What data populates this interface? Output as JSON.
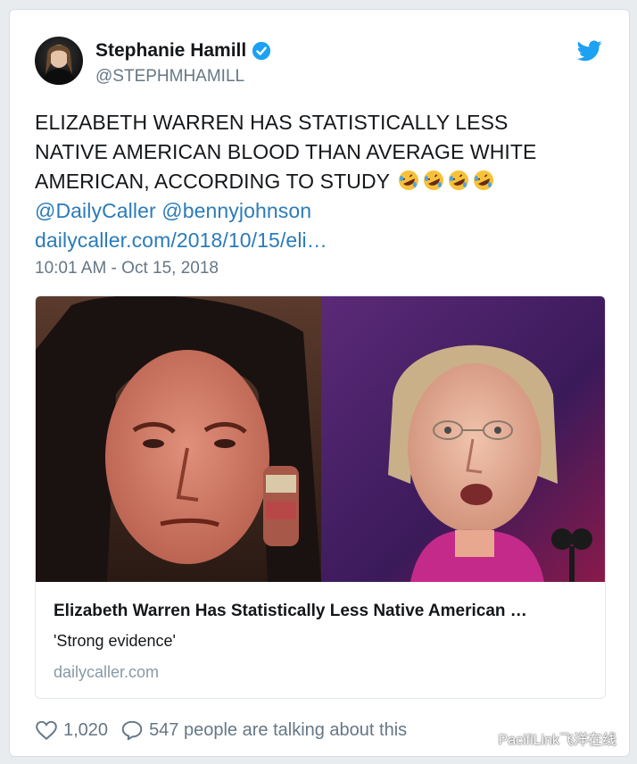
{
  "user": {
    "display_name": "Stephanie Hamill",
    "handle": "@STEPHMHAMILL"
  },
  "tweet": {
    "text_lines": [
      "ELIZABETH WARREN HAS STATISTICALLY LESS",
      "NATIVE AMERICAN BLOOD THAN AVERAGE WHITE",
      "AMERICAN, ACCORDING TO STUDY"
    ],
    "emoji_count": 4,
    "mentions": [
      "@DailyCaller",
      "@bennyjohnson"
    ],
    "link": "dailycaller.com/2018/10/15/eli…",
    "timestamp": "10:01 AM - Oct 15, 2018"
  },
  "card": {
    "title": "Elizabeth Warren Has Statistically Less Native American …",
    "description": "'Strong evidence'",
    "domain": "dailycaller.com"
  },
  "actions": {
    "likes": "1,020",
    "talking": "547 people are talking about this"
  },
  "watermark": {
    "text": "PacifiLink飞洋在线"
  },
  "colors": {
    "link": "#2b7bb9",
    "verified": "#1da1f2",
    "muted": "#657786"
  }
}
